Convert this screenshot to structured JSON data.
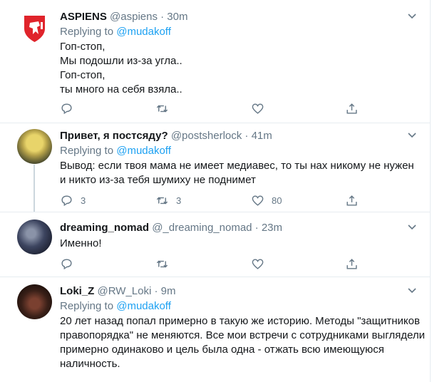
{
  "tweets": [
    {
      "name": "ASPIENS",
      "meta": "@aspiens · 30m",
      "reply_prefix": "Replying to ",
      "reply_to": "@mudakoff",
      "lines": [
        "Гоп-стоп,",
        "Мы подошли из-за угла..",
        "Гоп-стоп,",
        "ты много на себя взяла.."
      ],
      "replies": "",
      "retweets": "",
      "likes": ""
    },
    {
      "name": "Привет, я постсяду?",
      "meta": "@postsherlock · 41m",
      "reply_prefix": "Replying to ",
      "reply_to": "@mudakoff",
      "lines": [
        "Вывод: если твоя мама не имеет медиавес, то ты нах    никому не нужен",
        "и никто из-за тебя шумиху не поднимет"
      ],
      "replies": "3",
      "retweets": "3",
      "likes": "80"
    },
    {
      "name": "dreaming_nomad",
      "meta": "@_dreaming_nomad · 23m",
      "lines": [
        "Именно!"
      ],
      "replies": "",
      "retweets": "",
      "likes": ""
    },
    {
      "name": "Loki_Z",
      "meta": "@RW_Loki · 9m",
      "reply_prefix": "Replying to ",
      "reply_to": "@mudakoff",
      "lines": [
        "20 лет назад попал примерно в такую же историю. Методы \"защитников",
        "правопорядка\" не меняются. Все мои встречи с сотрудниками выглядели",
        "примерно одинаково и цель была одна - отжать всю имеющуюся",
        "наличность."
      ]
    }
  ],
  "colors": {
    "accent": "#1da1f2",
    "muted": "#657786",
    "text": "#14171a",
    "border": "#e6ecf0"
  },
  "icons": [
    "reply-icon",
    "retweet-icon",
    "like-icon",
    "share-icon",
    "chevron-down-icon"
  ]
}
